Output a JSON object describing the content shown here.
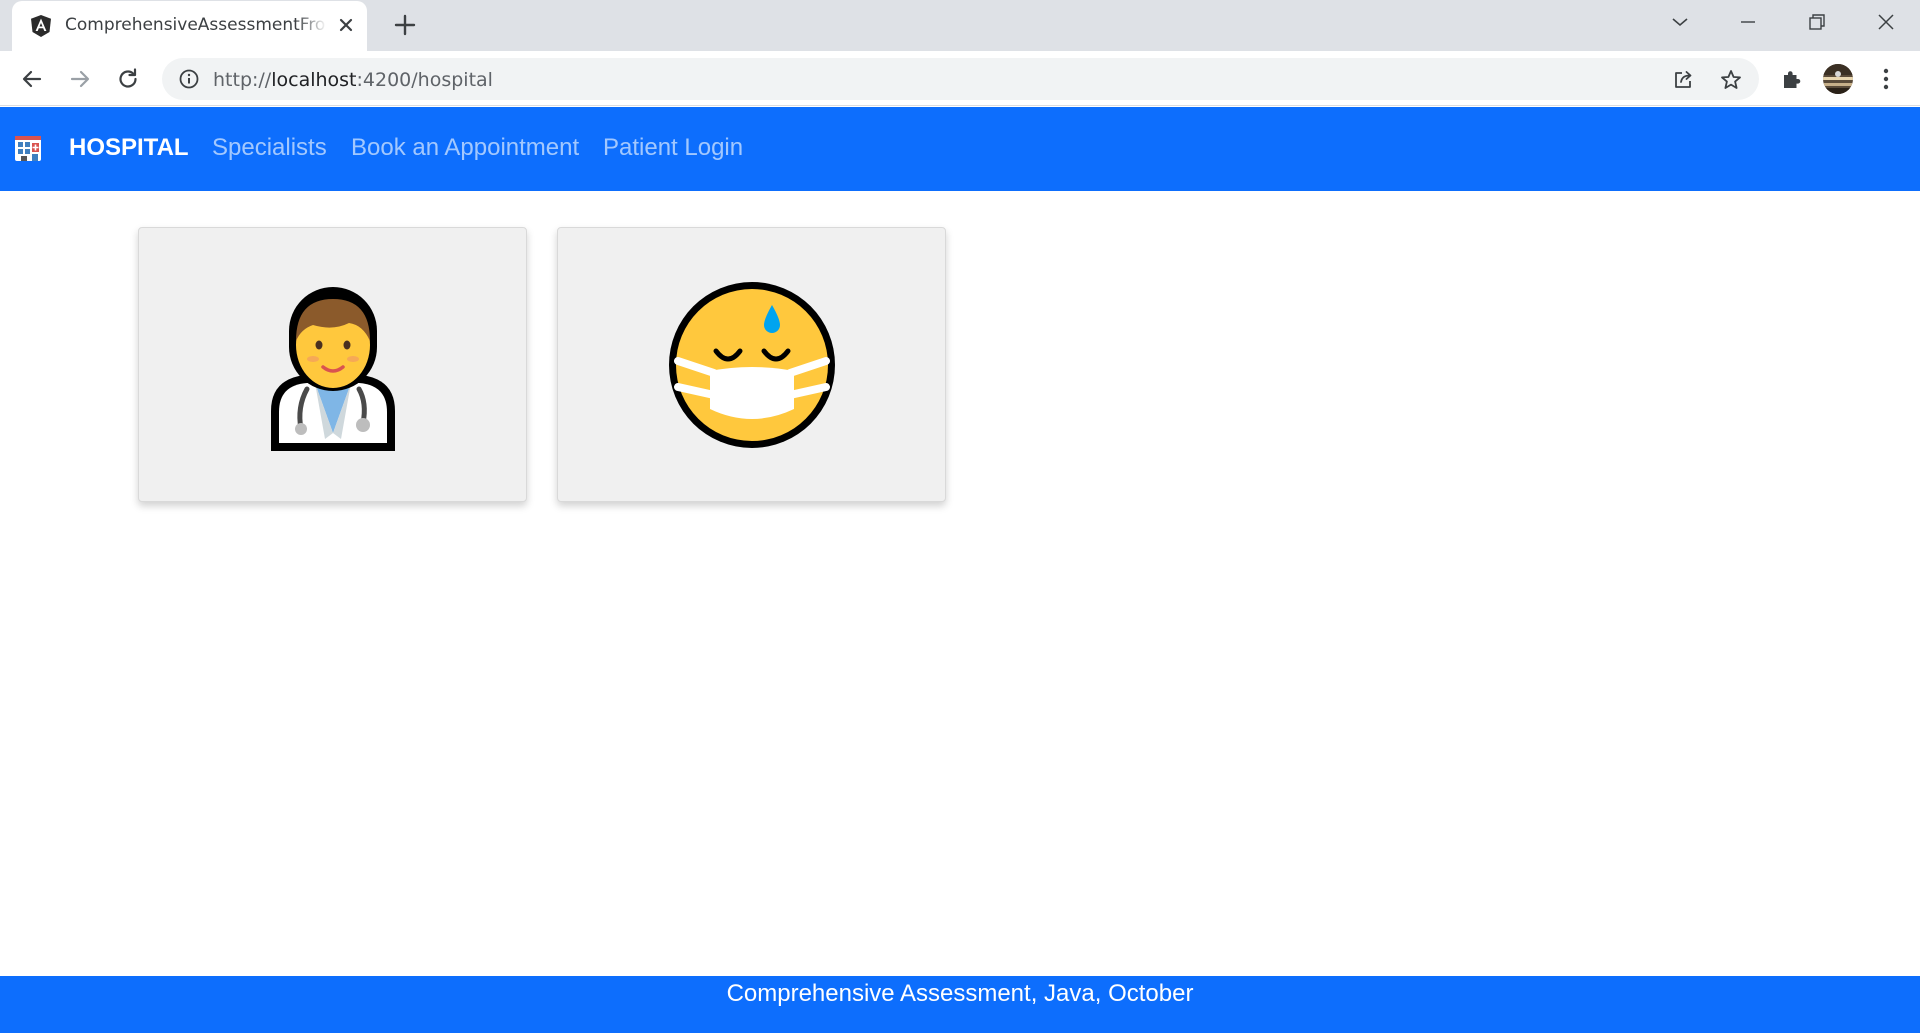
{
  "browser": {
    "tab": {
      "title": "ComprehensiveAssessmentFrontend",
      "favicon": "angular-icon"
    },
    "url": {
      "scheme": "http://",
      "host": "localhost",
      "path": ":4200/hospital"
    },
    "icons": [
      "back-arrow-icon",
      "forward-arrow-icon",
      "reload-icon",
      "info-icon",
      "share-icon",
      "star-icon",
      "puzzle-icon",
      "avatar",
      "kebab-menu-icon"
    ]
  },
  "navbar": {
    "brand": "HOSPITAL",
    "links": [
      "Specialists",
      "Book an Appointment",
      "Patient Login"
    ],
    "color": "#0d6efd"
  },
  "cards": [
    {
      "name": "doctor",
      "icon": "doctor-emoji-icon"
    },
    {
      "name": "patient",
      "icon": "face-with-medical-mask-emoji-icon"
    }
  ],
  "footer": {
    "text": "Comprehensive Assessment, Java, October"
  }
}
